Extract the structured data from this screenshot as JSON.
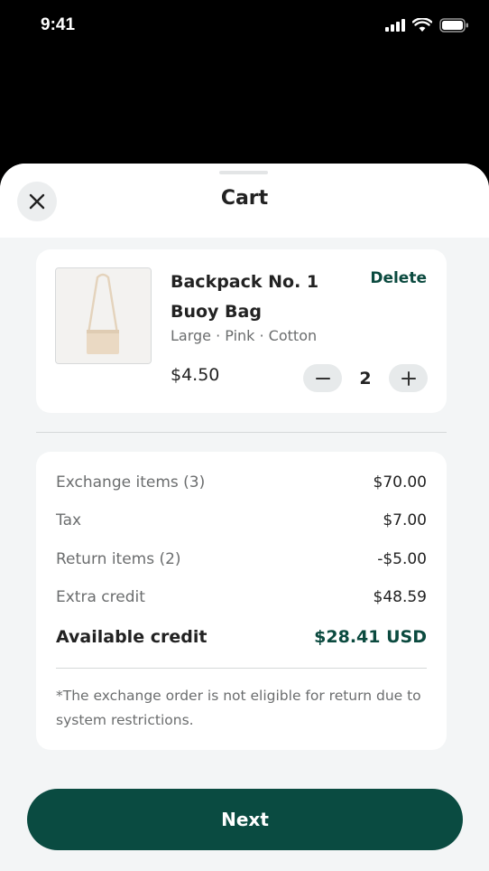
{
  "status_bar": {
    "time": "9:41"
  },
  "header": {
    "title": "Cart"
  },
  "cart_item": {
    "name_line1": "Backpack No. 1",
    "name_line2": "Buoy Bag",
    "variant": "Large · Pink · Cotton",
    "price": "$4.50",
    "quantity": "2",
    "delete_label": "Delete"
  },
  "summary": {
    "rows": [
      {
        "label": "Exchange items (3)",
        "value": "$70.00"
      },
      {
        "label": "Tax",
        "value": "$7.00"
      },
      {
        "label": "Return items (2)",
        "value": "-$5.00"
      },
      {
        "label": "Extra credit",
        "value": "$48.59"
      }
    ],
    "total": {
      "label": "Available credit",
      "value": "$28.41 USD"
    },
    "note": "*The exchange order is not eligible for return due to system restrictions."
  },
  "footer": {
    "next_label": "Next"
  },
  "colors": {
    "accent": "#0a4b41",
    "background": "#f3f5f6"
  },
  "icons": [
    "close-icon",
    "minus-icon",
    "plus-icon",
    "signal-icon",
    "wifi-icon",
    "battery-icon"
  ]
}
